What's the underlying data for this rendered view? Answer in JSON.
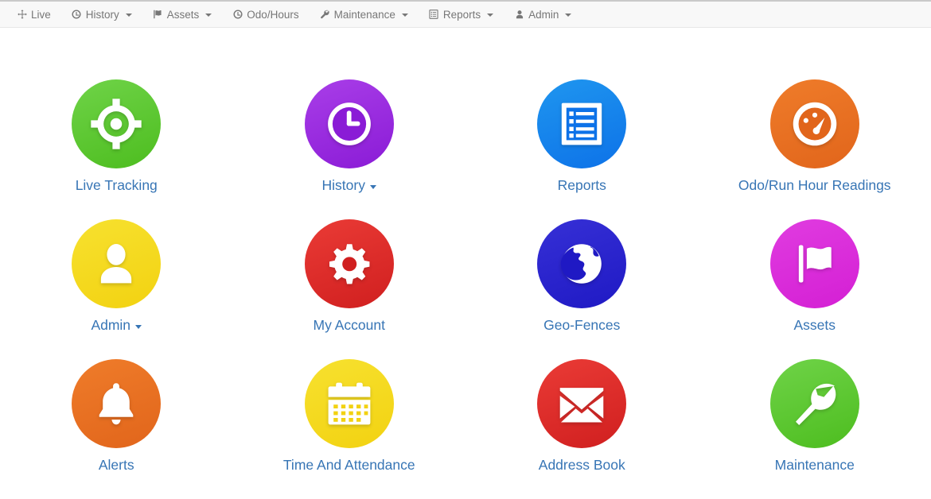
{
  "navbar": {
    "items": [
      {
        "label": "Live",
        "icon": "move-arrows-icon",
        "caret": false
      },
      {
        "label": "History",
        "icon": "clock-icon",
        "caret": true
      },
      {
        "label": "Assets",
        "icon": "flag-icon",
        "caret": true
      },
      {
        "label": "Odo/Hours",
        "icon": "clock-icon",
        "caret": false
      },
      {
        "label": "Maintenance",
        "icon": "wrench-icon",
        "caret": true
      },
      {
        "label": "Reports",
        "icon": "list-icon",
        "caret": true
      },
      {
        "label": "Admin",
        "icon": "user-icon",
        "caret": true
      }
    ]
  },
  "tiles": [
    {
      "label": "Live Tracking",
      "icon": "crosshairs-icon",
      "caret": false,
      "color_from": "#6fd348",
      "color_to": "#4dbd1f"
    },
    {
      "label": "History",
      "icon": "clock-icon",
      "caret": true,
      "color_from": "#a93ee8",
      "color_to": "#8a1bd6"
    },
    {
      "label": "Reports",
      "icon": "list-icon",
      "caret": false,
      "color_from": "#1f96ef",
      "color_to": "#0d72e8"
    },
    {
      "label": "Odo/Run Hour Readings",
      "icon": "tachometer-icon",
      "caret": false,
      "color_from": "#ef7c2a",
      "color_to": "#e1651b"
    },
    {
      "label": "Admin",
      "icon": "user-icon",
      "caret": true,
      "color_from": "#f7e12f",
      "color_to": "#f2d211"
    },
    {
      "label": "My Account",
      "icon": "gear-icon",
      "caret": false,
      "color_from": "#ea3b36",
      "color_to": "#d01f1f"
    },
    {
      "label": "Geo-Fences",
      "icon": "globe-icon",
      "caret": false,
      "color_from": "#3630d6",
      "color_to": "#1f19c4"
    },
    {
      "label": "Assets",
      "icon": "flag-icon",
      "caret": false,
      "color_from": "#e03ce0",
      "color_to": "#d41fd4"
    },
    {
      "label": "Alerts",
      "icon": "bell-icon",
      "caret": false,
      "color_from": "#ef7c2a",
      "color_to": "#e1651b"
    },
    {
      "label": "Time And Attendance",
      "icon": "calendar-icon",
      "caret": false,
      "color_from": "#f7e12f",
      "color_to": "#f2d211"
    },
    {
      "label": "Address Book",
      "icon": "envelope-icon",
      "caret": false,
      "color_from": "#ea3b36",
      "color_to": "#d01f1f"
    },
    {
      "label": "Maintenance",
      "icon": "wrench-icon",
      "caret": false,
      "color_from": "#6fd348",
      "color_to": "#4dbd1f"
    }
  ],
  "colors": {
    "link": "#3775b5",
    "navbar_bg": "#f8f8f8",
    "navbar_text": "#777777",
    "page_bg": "#ffffff"
  }
}
